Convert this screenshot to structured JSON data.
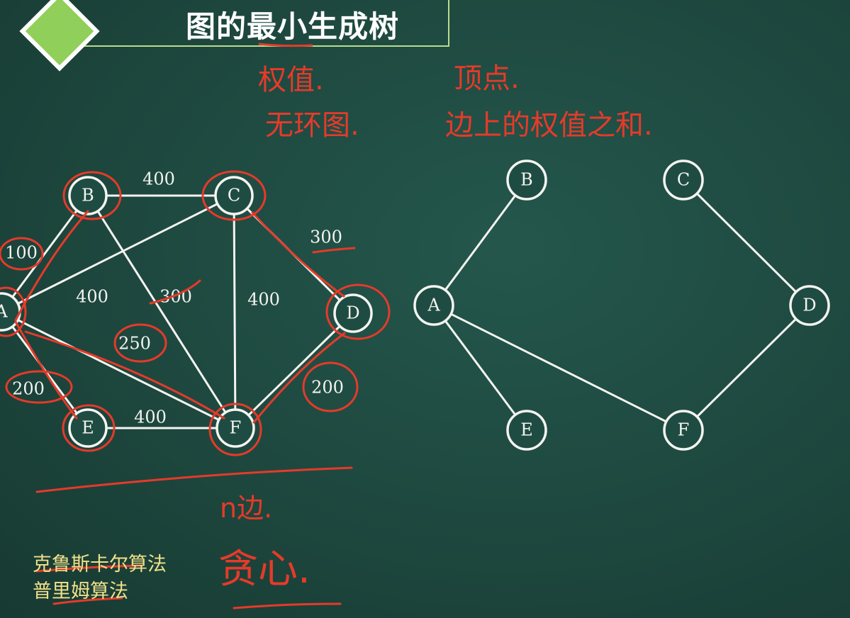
{
  "title": "图的最小生成树",
  "algorithms": [
    "克鲁斯卡尔算法",
    "普里姆算法"
  ],
  "annotations": {
    "weight": "权值.",
    "no_cycle": "无环图.",
    "vertex": "顶点.",
    "edge_sum": "边上的权值之和.",
    "n_edges": "n边.",
    "greedy": "贪心."
  },
  "colors": {
    "board": "#1e4a40",
    "chalk": "#f4f4f0",
    "ink": "#e63a2a",
    "title_accent": "#8fcf5a",
    "algo_text": "#f0e08a"
  },
  "graph": {
    "nodes": [
      "A",
      "B",
      "C",
      "D",
      "E",
      "F"
    ],
    "edges": [
      {
        "from": "A",
        "to": "B",
        "weight": "100"
      },
      {
        "from": "B",
        "to": "C",
        "weight": "400"
      },
      {
        "from": "C",
        "to": "D",
        "weight": "300"
      },
      {
        "from": "A",
        "to": "C",
        "weight": "400"
      },
      {
        "from": "B",
        "to": "F",
        "weight": "300"
      },
      {
        "from": "C",
        "to": "F",
        "weight": "400"
      },
      {
        "from": "A",
        "to": "F",
        "weight": "250"
      },
      {
        "from": "A",
        "to": "E",
        "weight": "200"
      },
      {
        "from": "D",
        "to": "F",
        "weight": "200"
      },
      {
        "from": "E",
        "to": "F",
        "weight": "400"
      }
    ]
  },
  "tree": {
    "nodes": [
      "A",
      "B",
      "C",
      "D",
      "E",
      "F"
    ],
    "edges": [
      {
        "from": "A",
        "to": "B"
      },
      {
        "from": "C",
        "to": "D"
      },
      {
        "from": "A",
        "to": "E"
      },
      {
        "from": "A",
        "to": "F"
      },
      {
        "from": "D",
        "to": "F"
      }
    ]
  }
}
